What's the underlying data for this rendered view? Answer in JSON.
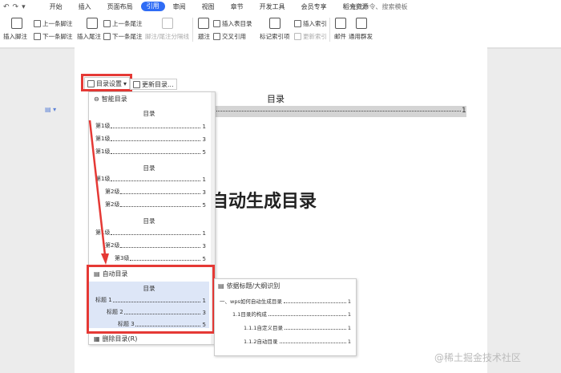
{
  "menubar": {
    "quick_icons": [
      "↶",
      "↷",
      "▾"
    ],
    "tabs": [
      "开始",
      "插入",
      "页面布局",
      "引用",
      "审阅",
      "视图",
      "章节",
      "开发工具",
      "会员专享",
      "稻壳资源"
    ],
    "active_tab": "引用",
    "search_placeholder": "查找命令、搜索模板"
  },
  "ribbon": {
    "insert_footnote": "插入脚注",
    "prev_footnote": "上一条脚注",
    "next_footnote": "下一条脚注",
    "insert_endnote": "插入尾注",
    "prev_endnote": "上一条尾注",
    "next_endnote": "下一条尾注",
    "separator_line": "脚注/尾注分隔线",
    "caption": "题注",
    "insert_table_of_figures": "插入表目录",
    "cross_reference": "交叉引用",
    "mark_index_entry": "标记索引项",
    "insert_index": "插入索引",
    "update_index": "更新索引",
    "mail": "邮件",
    "send_document": "通用群发"
  },
  "doc": {
    "toc_settings_button": "目录设置",
    "update_toc_button": "更新目录...",
    "toc_title": "目录",
    "toc_page": "1",
    "main_title": "自动生成目录"
  },
  "dropdown": {
    "smart_toc_label": "智能目录",
    "block_title": "目录",
    "block1": [
      {
        "label": "第1级",
        "page": "1"
      },
      {
        "label": "第1级",
        "page": "3"
      },
      {
        "label": "第1级",
        "page": "5"
      }
    ],
    "block2": [
      {
        "label": "第1级",
        "page": "1"
      },
      {
        "label": "第2级",
        "page": "3"
      },
      {
        "label": "第2级",
        "page": "5"
      }
    ],
    "block3": [
      {
        "label": "第1级",
        "page": "1"
      },
      {
        "label": "第2级",
        "page": "3"
      },
      {
        "label": "第3级",
        "page": "5"
      }
    ],
    "auto_toc_label": "自动目录",
    "auto_block": [
      {
        "label": "标题 1",
        "page": "1"
      },
      {
        "label": "标题 2",
        "page": "3"
      },
      {
        "label": "标题 3",
        "page": "5"
      }
    ],
    "delete_toc_label": "删除目录(R)"
  },
  "popup": {
    "header": "依据标题/大纲识别",
    "entries": [
      {
        "label": "一、wps如何自动生成目录",
        "page": "1"
      },
      {
        "label": "1.1目录的构成",
        "page": "1"
      },
      {
        "label": "1.1.1自定义目录",
        "page": "1"
      },
      {
        "label": "1.1.2自动目录",
        "page": "1"
      }
    ]
  },
  "watermark": "@稀土掘金技术社区",
  "colors": {
    "accent": "#2f6cf5",
    "highlight_box": "#e53935",
    "arrow": "#e53935"
  }
}
